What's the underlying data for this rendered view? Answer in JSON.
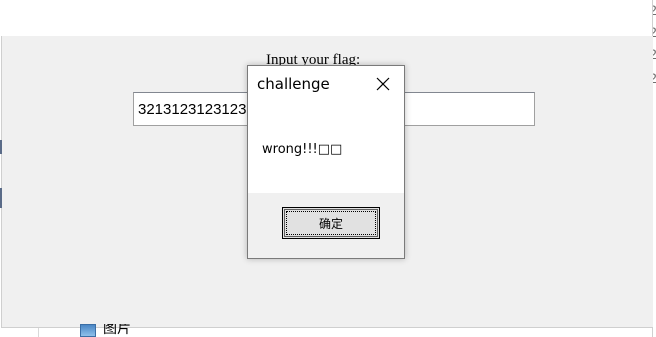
{
  "window": {
    "flag_label": "Input your flag:",
    "flag_input_value": "32131231231232"
  },
  "dialog": {
    "title": "challenge",
    "message": "wrong!!!□□",
    "ok_label": "确定",
    "close_icon": "close-icon"
  },
  "explorer": {
    "tree_item_label": "图片",
    "tree_item_icon": "image-folder-icon"
  },
  "colors": {
    "client_bg": "#f0f0f0",
    "dialog_bg": "#ffffff",
    "dialog_footer_bg": "#f0f0f0",
    "button_bg": "#e1e1e1"
  }
}
